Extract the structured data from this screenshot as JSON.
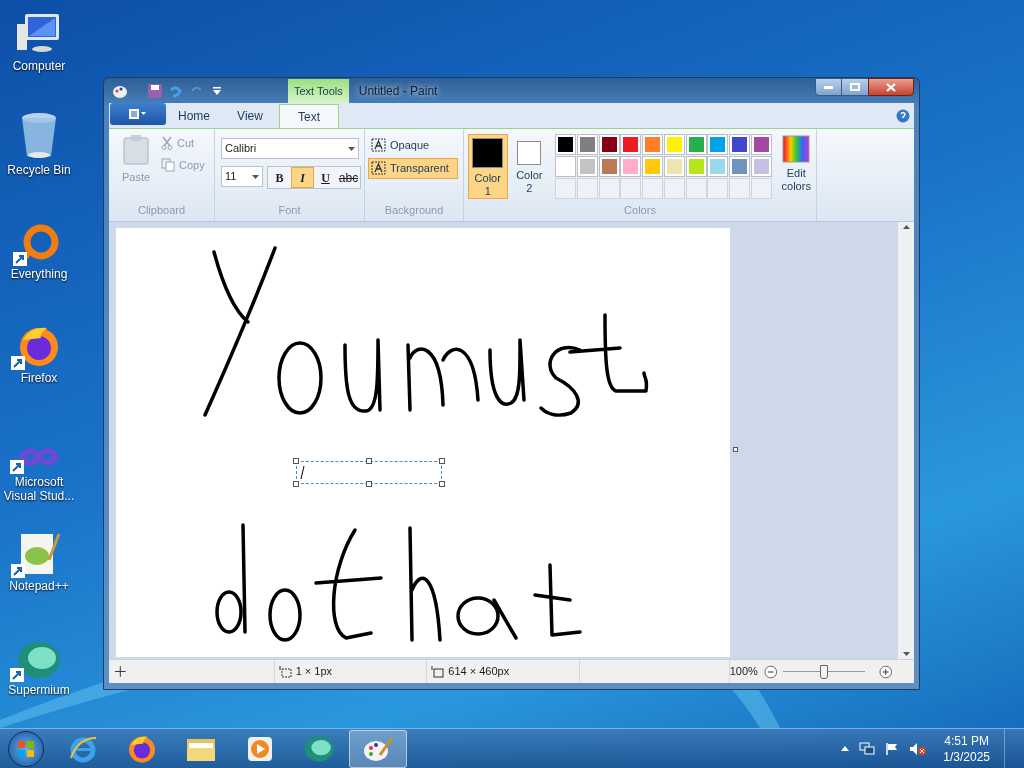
{
  "desktop_icons": [
    {
      "label": "Computer",
      "kind": "computer",
      "shortcut": false
    },
    {
      "label": "Recycle Bin",
      "kind": "bin",
      "shortcut": false
    },
    {
      "label": "Everything",
      "kind": "ring",
      "shortcut": true
    },
    {
      "label": "Firefox",
      "kind": "firefox",
      "shortcut": true
    },
    {
      "label": "Microsoft Visual Stud...",
      "kind": "infinity",
      "shortcut": true
    },
    {
      "label": "Notepad++",
      "kind": "notepad",
      "shortcut": true
    },
    {
      "label": "Supermium",
      "kind": "sphere",
      "shortcut": true
    }
  ],
  "window": {
    "title": "Untitled - Paint",
    "contextual_tab": "Text Tools",
    "tabs": [
      {
        "label": "Home",
        "selected": false
      },
      {
        "label": "View",
        "selected": false
      },
      {
        "label": "Text",
        "selected": true
      }
    ],
    "clipboard": {
      "label": "Clipboard",
      "paste": "Paste",
      "cut": "Cut",
      "copy": "Copy",
      "disabled": true
    },
    "font": {
      "label": "Font",
      "family": "Calibri",
      "size": "11",
      "styles": [
        {
          "label": "B",
          "kind": "bold",
          "selected": false
        },
        {
          "label": "I",
          "kind": "italic",
          "selected": true
        },
        {
          "label": "U",
          "kind": "underline",
          "selected": false
        },
        {
          "label": "abc",
          "kind": "strike",
          "selected": false
        }
      ]
    },
    "background": {
      "label": "Background",
      "options": [
        {
          "label": "Opaque",
          "selected": false
        },
        {
          "label": "Transparent",
          "selected": true
        }
      ]
    },
    "colors": {
      "label": "Colors",
      "slots": [
        {
          "label": "Color 1",
          "color": "#000000",
          "selected": true
        },
        {
          "label": "Color 2",
          "color": "#ffffff",
          "selected": false
        }
      ],
      "palette": [
        {
          "color": "#000000"
        },
        {
          "color": "#7f7f7f"
        },
        {
          "color": "#880015"
        },
        {
          "color": "#ed1c24"
        },
        {
          "color": "#ff7f27"
        },
        {
          "color": "#fff200"
        },
        {
          "color": "#22b14c"
        },
        {
          "color": "#00a2e8"
        },
        {
          "color": "#3f48cc"
        },
        {
          "color": "#a349a4"
        },
        {
          "color": "#ffffff"
        },
        {
          "color": "#c3c3c3"
        },
        {
          "color": "#b97a57"
        },
        {
          "color": "#ffaec9"
        },
        {
          "color": "#ffc90e"
        },
        {
          "color": "#efe4b0"
        },
        {
          "color": "#b5e61d"
        },
        {
          "color": "#99d9ea"
        },
        {
          "color": "#7092be"
        },
        {
          "color": "#c8bfe7"
        }
      ],
      "edit": "Edit colors"
    },
    "status_bar": {
      "selection": "1 × 1px",
      "size": "614 × 460px",
      "zoom": "100%",
      "zoom_level": {
        "level": 0.5
      }
    }
  },
  "taskbar": {
    "apps": [
      {
        "kind": "ie",
        "selected": false
      },
      {
        "kind": "firefox",
        "selected": false
      },
      {
        "kind": "folder",
        "selected": false
      },
      {
        "kind": "media",
        "selected": false
      },
      {
        "kind": "sphere",
        "selected": false
      },
      {
        "kind": "paint",
        "selected": true
      }
    ],
    "time": "4:51 PM",
    "date": "1/3/2025"
  }
}
